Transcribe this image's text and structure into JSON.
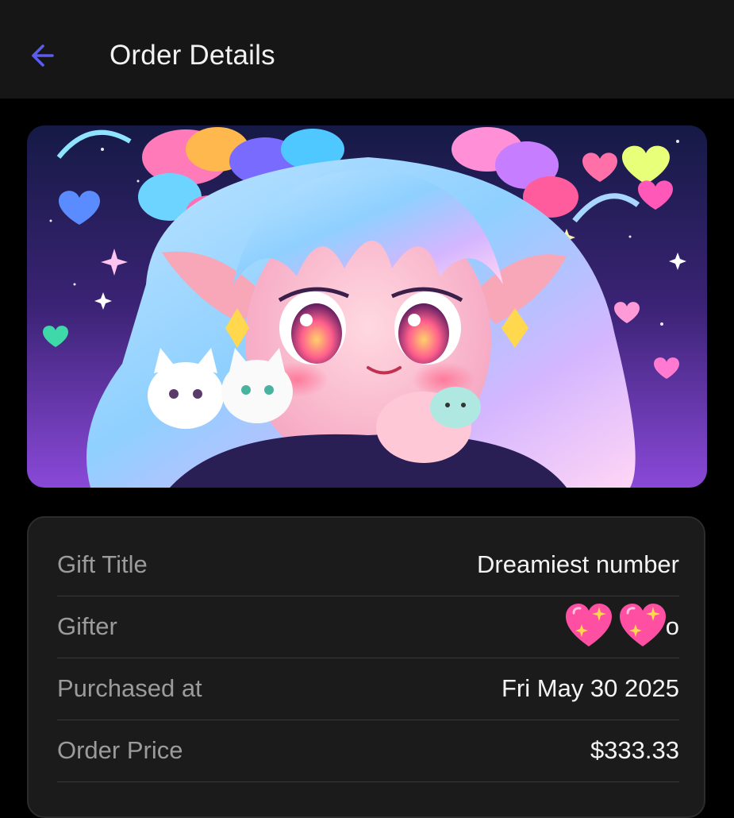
{
  "header": {
    "title": "Order Details",
    "back_icon": "arrow-left-icon",
    "accent": "#5b5cf0"
  },
  "hero": {
    "image": "anime-elf-girl-with-kittens-illustration"
  },
  "details": {
    "rows": [
      {
        "label": "Gift Title",
        "value": "Dreamiest number"
      },
      {
        "label": "Gifter",
        "value": "o",
        "icons": [
          "sparkling-heart-icon",
          "sparkling-heart-icon"
        ]
      },
      {
        "label": "Purchased at",
        "value": "Fri May 30 2025"
      },
      {
        "label": "Order Price",
        "value": "$333.33"
      }
    ]
  }
}
